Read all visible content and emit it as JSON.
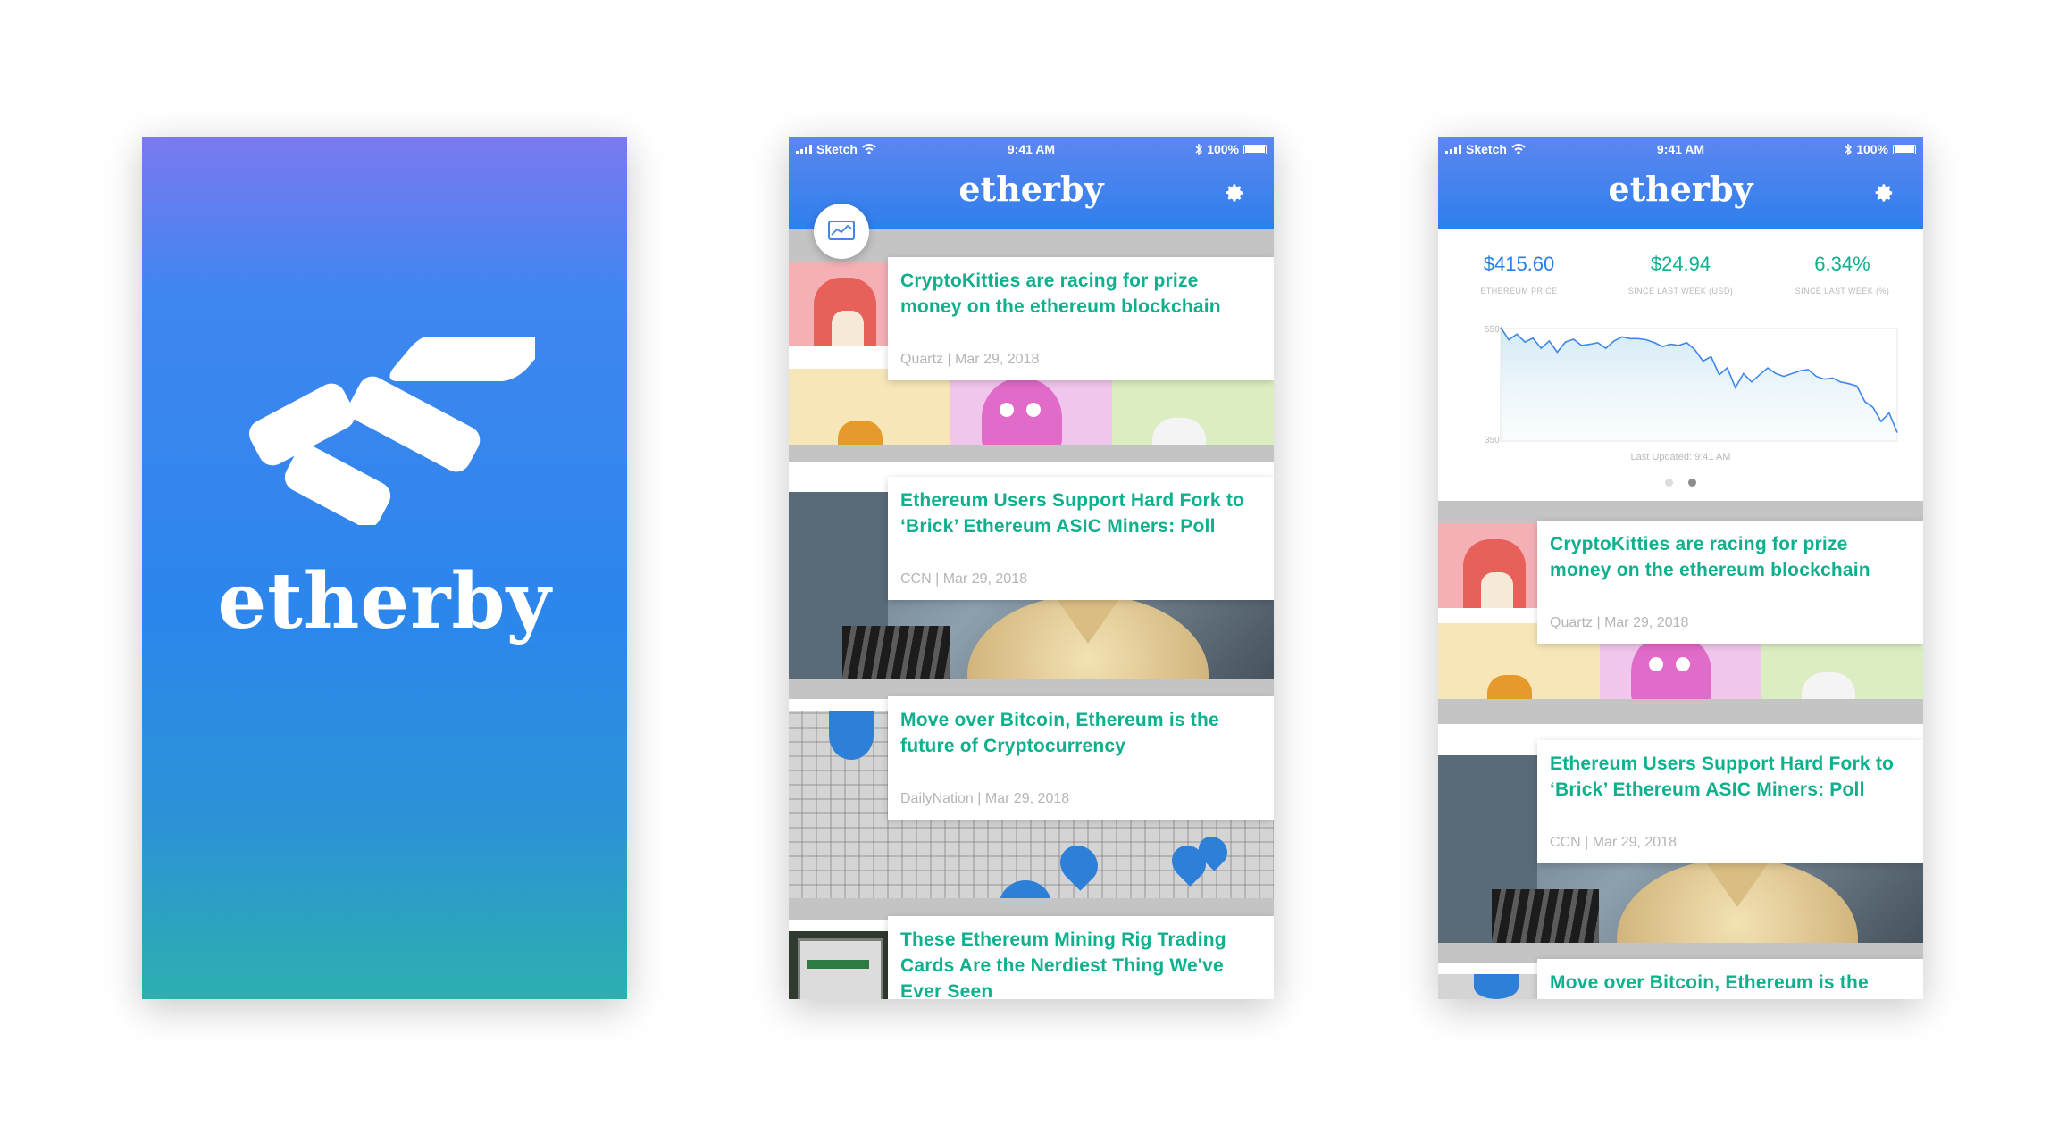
{
  "splash": {
    "brand": "etherby"
  },
  "status_bar": {
    "carrier": "Sketch",
    "time": "9:41 AM",
    "battery": "100%"
  },
  "nav": {
    "title": "etherby",
    "settings_icon": "gear-icon",
    "chart_icon": "chart-icon"
  },
  "articles": [
    {
      "title": "CryptoKitties are racing for prize money on the ethereum blockchain",
      "meta": "Quartz | Mar 29, 2018"
    },
    {
      "title": "Ethereum Users Support Hard Fork to ‘Brick’ Ethereum ASIC Miners: Poll",
      "meta": "CCN | Mar 29, 2018"
    },
    {
      "title": "Move over Bitcoin, Ethereum is the future of Cryptocurrency",
      "meta": "DailyNation | Mar 29, 2018"
    },
    {
      "title": "These Ethereum Mining Rig Trading Cards Are the Nerdiest Thing We've Ever Seen",
      "meta": ""
    }
  ],
  "market": {
    "stats": [
      {
        "value": "$415.60",
        "label": "ETHEREUM PRICE"
      },
      {
        "value": "$24.94",
        "label": "SINCE LAST WEEK (USD)"
      },
      {
        "value": "6.34%",
        "label": "SINCE LAST WEEK (%)"
      }
    ],
    "last_updated": "Last Updated: 9:41 AM",
    "page_dots": 2,
    "active_dot": 2
  },
  "colors": {
    "accent_green": "#0eb08d",
    "price_blue": "#2b7de9",
    "nav_blue": "#2e7fec",
    "line_blue": "#3f86e8"
  },
  "chart_data": {
    "type": "area",
    "title": "",
    "xlabel": "",
    "ylabel": "",
    "ylim": [
      350,
      550
    ],
    "yticks": [
      "550",
      "350"
    ],
    "series": [
      {
        "values": [
          552,
          530,
          540,
          526,
          533,
          515,
          528,
          508,
          526,
          531,
          520,
          522,
          525,
          515,
          528,
          535,
          532,
          532,
          530,
          525,
          518,
          522,
          520,
          525,
          512,
          492,
          500,
          468,
          480,
          445,
          470,
          455,
          468,
          480,
          470,
          465,
          470,
          475,
          477,
          465,
          460,
          462,
          455,
          452,
          448,
          420,
          410,
          385,
          400,
          365
        ]
      }
    ]
  }
}
